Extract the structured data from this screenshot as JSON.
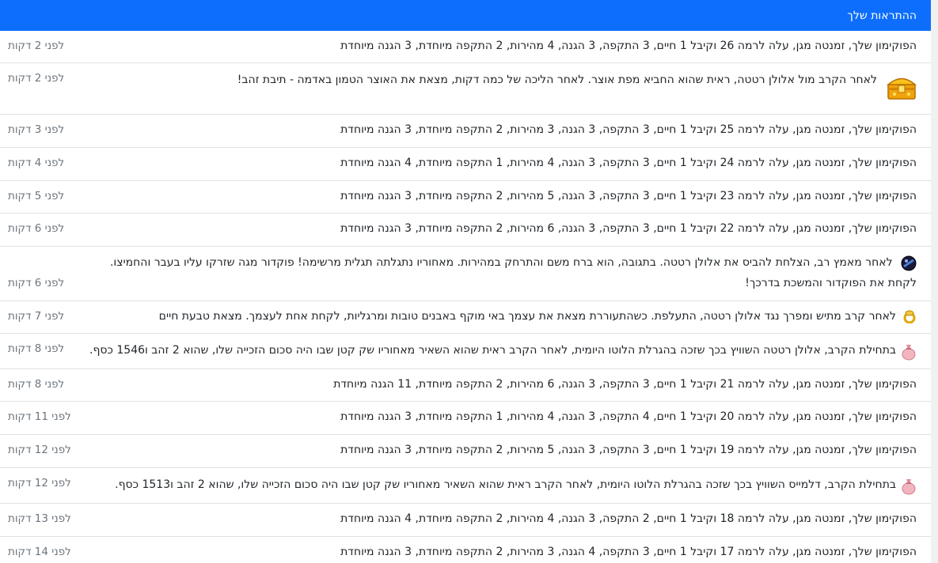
{
  "header": {
    "title": "ההתראות שלך"
  },
  "notifications": [
    {
      "text": "הפוקימון שלך, זמנטה מגן, עלה לרמה 26 וקיבל 1 חיים, 3 התקפה, 3 הגנה, 4 מהירות, 2 התקפה מיוחדת, 3 הגנה מיוחדת",
      "time": "לפני 2 דקות"
    },
    {
      "icon": "treasure-chest-icon",
      "text": "לאחר הקרב מול אלולן רטטה, ראית שהוא החביא מפת אוצר. לאחר הליכה של כמה דקות, מצאת את האוצר הטמון באדמה - תיבת זהב!",
      "time": "לפני 2 דקות"
    },
    {
      "text": "הפוקימון שלך, זמנטה מגן, עלה לרמה 25 וקיבל 1 חיים, 3 התקפה, 3 הגנה, 3 מהירות, 2 התקפה מיוחדת, 3 הגנה מיוחדת",
      "time": "לפני 3 דקות"
    },
    {
      "text": "הפוקימון שלך, זמנטה מגן, עלה לרמה 24 וקיבל 1 חיים, 3 התקפה, 3 הגנה, 4 מהירות, 1 התקפה מיוחדת, 4 הגנה מיוחדת",
      "time": "לפני 4 דקות"
    },
    {
      "text": "הפוקימון שלך, זמנטה מגן, עלה לרמה 23 וקיבל 1 חיים, 3 התקפה, 3 הגנה, 5 מהירות, 2 התקפה מיוחדת, 3 הגנה מיוחדת",
      "time": "לפני 5 דקות"
    },
    {
      "text": "הפוקימון שלך, זמנטה מגן, עלה לרמה 22 וקיבל 1 חיים, 3 התקפה, 3 הגנה, 6 מהירות, 2 התקפה מיוחדת, 3 הגנה מיוחדת",
      "time": "לפני 6 דקות"
    },
    {
      "icon": "pokedex-orb-icon",
      "text": "לאחר מאמץ רב, הצלחת להביס את אלולן רטטה. בתגובה, הוא ברח משם והתרחק במהירות. מאחוריו נתגלתה תגלית מרשימה! פוקדור מגה שזרקו עליו בעבר והחמיצו. לקחת את הפוקדור והמשכת בדרכך!",
      "time": "לפני 6 דקות"
    },
    {
      "icon": "life-ring-icon",
      "text": "לאחר קרב מתיש ומפרך נגד אלולן רטטה, התעלפת. כשהתעוררת מצאת את עצמך באי מוקף באבנים טובות ומרגליות, לקחת אחת לעצמך. מצאת טבעת חיים",
      "time": "לפני 7 דקות"
    },
    {
      "icon": "money-bag-icon",
      "text": "בתחילת הקרב, אלולן רטטה השוויץ בכך שזכה בהגרלת הלוטו היומית, לאחר הקרב ראית שהוא השאיר מאחוריו שק קטן שבו היה סכום הזכייה שלו, שהוא 2 זהב ו1546 כסף.",
      "time": "לפני 8 דקות"
    },
    {
      "text": "הפוקימון שלך, זמנטה מגן, עלה לרמה 21 וקיבל 1 חיים, 3 התקפה, 3 הגנה, 6 מהירות, 2 התקפה מיוחדת, 11 הגנה מיוחדת",
      "time": "לפני 8 דקות"
    },
    {
      "text": "הפוקימון שלך, זמנטה מגן, עלה לרמה 20 וקיבל 1 חיים, 4 התקפה, 3 הגנה, 4 מהירות, 1 התקפה מיוחדת, 3 הגנה מיוחדת",
      "time": "לפני 11 דקות"
    },
    {
      "text": "הפוקימון שלך, זמנטה מגן, עלה לרמה 19 וקיבל 1 חיים, 3 התקפה, 3 הגנה, 5 מהירות, 2 התקפה מיוחדת, 3 הגנה מיוחדת",
      "time": "לפני 12 דקות"
    },
    {
      "icon": "money-bag-icon",
      "text": "בתחילת הקרב, דלמייס השוויץ בכך שזכה בהגרלת הלוטו היומית, לאחר הקרב ראית שהוא השאיר מאחוריו שק קטן שבו היה סכום הזכייה שלו, שהוא 2 זהב ו1513 כסף.",
      "time": "לפני 12 דקות"
    },
    {
      "text": "הפוקימון שלך, זמנטה מגן, עלה לרמה 18 וקיבל 1 חיים, 2 התקפה, 3 הגנה, 4 מהירות, 2 התקפה מיוחדת, 4 הגנה מיוחדת",
      "time": "לפני 13 דקות"
    },
    {
      "text": "הפוקימון שלך, זמנטה מגן, עלה לרמה 17 וקיבל 1 חיים, 3 התקפה, 4 הגנה, 3 מהירות, 2 התקפה מיוחדת, 3 הגנה מיוחדת",
      "time": "לפני 14 דקות"
    }
  ]
}
